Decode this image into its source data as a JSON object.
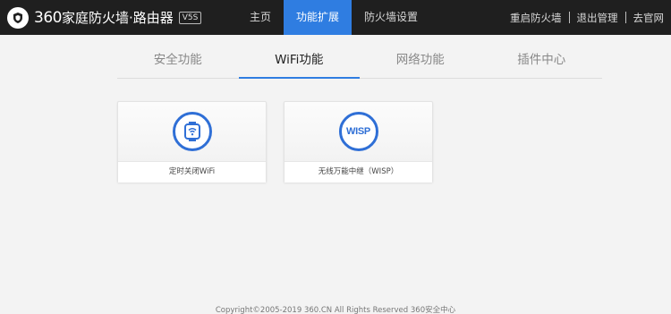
{
  "header": {
    "logo_num": "360",
    "logo_text": "家庭防火墙·路由器",
    "model_badge": "V5S",
    "nav": [
      {
        "label": "主页"
      },
      {
        "label": "功能扩展"
      },
      {
        "label": "防火墙设置"
      }
    ],
    "active_nav": "功能扩展",
    "links": [
      {
        "label": "重启防火墙"
      },
      {
        "label": "退出管理"
      },
      {
        "label": "去官网"
      }
    ]
  },
  "subtabs": [
    {
      "label": "安全功能"
    },
    {
      "label": "WiFi功能"
    },
    {
      "label": "网络功能"
    },
    {
      "label": "插件中心"
    }
  ],
  "active_subtab": "WiFi功能",
  "cards": [
    {
      "label": "定时关闭WiFi",
      "icon": "timer-wifi-icon"
    },
    {
      "label": "无线万能中继（WISP）",
      "icon": "wisp-icon",
      "icon_text": "WISP"
    }
  ],
  "footer": {
    "copyright": "Copyright©2005-2019 360.CN All Rights Reserved 360安全中心"
  },
  "colors": {
    "header_bg": "#1f1f1f",
    "accent": "#2f7de1",
    "icon_blue": "#2f6fd6",
    "page_bg": "#f3f3f3"
  }
}
